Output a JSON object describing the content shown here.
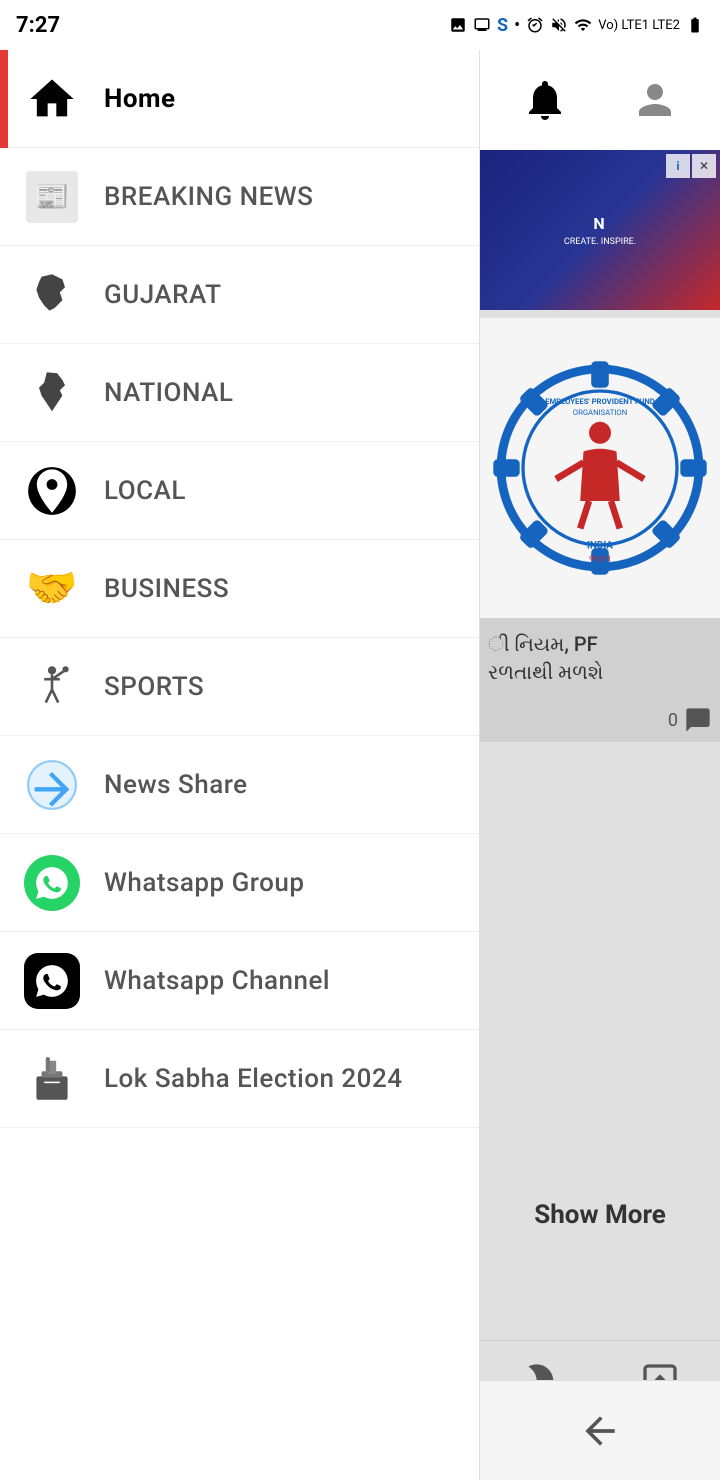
{
  "statusBar": {
    "time": "7:27",
    "icons": [
      "photo",
      "monitor",
      "S",
      "dot",
      "alarm",
      "mute",
      "wifi",
      "lte1",
      "lte2",
      "battery"
    ]
  },
  "sidebar": {
    "items": [
      {
        "id": "home",
        "label": "Home",
        "icon": "home-icon",
        "active": true
      },
      {
        "id": "breaking-news",
        "label": "BREAKING NEWS",
        "icon": "breaking-news-icon",
        "active": false
      },
      {
        "id": "gujarat",
        "label": "GUJARAT",
        "icon": "gujarat-icon",
        "active": false
      },
      {
        "id": "national",
        "label": "NATIONAL",
        "icon": "national-icon",
        "active": false
      },
      {
        "id": "local",
        "label": "LOCAL",
        "icon": "local-icon",
        "active": false
      },
      {
        "id": "business",
        "label": "BUSINESS",
        "icon": "business-icon",
        "active": false
      },
      {
        "id": "sports",
        "label": "SPORTS",
        "icon": "sports-icon",
        "active": false
      },
      {
        "id": "news-share",
        "label": "News Share",
        "icon": "news-share-icon",
        "active": false
      },
      {
        "id": "whatsapp-group",
        "label": "Whatsapp Group",
        "icon": "whatsapp-group-icon",
        "active": false
      },
      {
        "id": "whatsapp-channel",
        "label": "Whatsapp Channel",
        "icon": "whatsapp-channel-icon",
        "active": false
      },
      {
        "id": "lok-sabha",
        "label": "Lok Sabha Election 2024",
        "icon": "election-icon",
        "active": false
      }
    ]
  },
  "rightPanel": {
    "newsHeadline": "ી નિયમ, PF\nરળતાથી મળશે",
    "commentCount": "0",
    "showMoreLabel": "Show More"
  },
  "bottomNav": {
    "backIcon": "back-icon",
    "homeIcon": "circle-icon",
    "menuIcon": "menu-lines-icon"
  }
}
